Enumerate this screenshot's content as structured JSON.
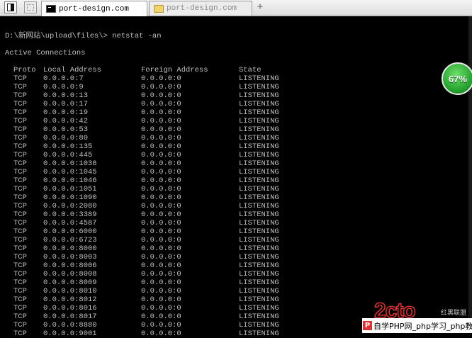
{
  "tabs": [
    {
      "label": "port-design.com",
      "icon": "cmd-icon",
      "active": true
    },
    {
      "label": "port-design.com",
      "icon": "folder-icon",
      "active": false
    }
  ],
  "new_tab_label": "+",
  "console": {
    "command_line": "D:\\新网站\\upload\\files\\> netstat -an",
    "title_line": "Active Connections",
    "headers": {
      "proto": "Proto",
      "local": "Local Address",
      "foreign": "Foreign Address",
      "state": "State"
    },
    "rows": [
      [
        "TCP",
        "0.0.0.0:7",
        "0.0.0.0:0",
        "LISTENING"
      ],
      [
        "TCP",
        "0.0.0.0:9",
        "0.0.0.0:0",
        "LISTENING"
      ],
      [
        "TCP",
        "0.0.0.0:13",
        "0.0.0.0:0",
        "LISTENING"
      ],
      [
        "TCP",
        "0.0.0.0:17",
        "0.0.0.0:0",
        "LISTENING"
      ],
      [
        "TCP",
        "0.0.0.0:19",
        "0.0.0.0:0",
        "LISTENING"
      ],
      [
        "TCP",
        "0.0.0.0:42",
        "0.0.0.0:0",
        "LISTENING"
      ],
      [
        "TCP",
        "0.0.0.0:53",
        "0.0.0.0:0",
        "LISTENING"
      ],
      [
        "TCP",
        "0.0.0.0:80",
        "0.0.0.0:0",
        "LISTENING"
      ],
      [
        "TCP",
        "0.0.0.0:135",
        "0.0.0.0:0",
        "LISTENING"
      ],
      [
        "TCP",
        "0.0.0.0:445",
        "0.0.0.0:0",
        "LISTENING"
      ],
      [
        "TCP",
        "0.0.0.0:1038",
        "0.0.0.0:0",
        "LISTENING"
      ],
      [
        "TCP",
        "0.0.0.0:1045",
        "0.0.0.0:0",
        "LISTENING"
      ],
      [
        "TCP",
        "0.0.0.0:1046",
        "0.0.0.0:0",
        "LISTENING"
      ],
      [
        "TCP",
        "0.0.0.0:1051",
        "0.0.0.0:0",
        "LISTENING"
      ],
      [
        "TCP",
        "0.0.0.0:1090",
        "0.0.0.0:0",
        "LISTENING"
      ],
      [
        "TCP",
        "0.0.0.0:2080",
        "0.0.0.0:0",
        "LISTENING"
      ],
      [
        "TCP",
        "0.0.0.0:3389",
        "0.0.0.0:0",
        "LISTENING"
      ],
      [
        "TCP",
        "0.0.0.0:4587",
        "0.0.0.0:0",
        "LISTENING"
      ],
      [
        "TCP",
        "0.0.0.0:6000",
        "0.0.0.0:0",
        "LISTENING"
      ],
      [
        "TCP",
        "0.0.0.0:6723",
        "0.0.0.0:0",
        "LISTENING"
      ],
      [
        "TCP",
        "0.0.0.0:8000",
        "0.0.0.0:0",
        "LISTENING"
      ],
      [
        "TCP",
        "0.0.0.0:8003",
        "0.0.0.0:0",
        "LISTENING"
      ],
      [
        "TCP",
        "0.0.0.0:8006",
        "0.0.0.0:0",
        "LISTENING"
      ],
      [
        "TCP",
        "0.0.0.0:8008",
        "0.0.0.0:0",
        "LISTENING"
      ],
      [
        "TCP",
        "0.0.0.0:8009",
        "0.0.0.0:0",
        "LISTENING"
      ],
      [
        "TCP",
        "0.0.0.0:8010",
        "0.0.0.0:0",
        "LISTENING"
      ],
      [
        "TCP",
        "0.0.0.0:8012",
        "0.0.0.0:0",
        "LISTENING"
      ],
      [
        "TCP",
        "0.0.0.0:8016",
        "0.0.0.0:0",
        "LISTENING"
      ],
      [
        "TCP",
        "0.0.0.0:8017",
        "0.0.0.0:0",
        "LISTENING"
      ],
      [
        "TCP",
        "0.0.0.0:8880",
        "0.0.0.0:0",
        "LISTENING"
      ],
      [
        "TCP",
        "0.0.0.0:9001",
        "0.0.0.0:0",
        "LISTENING"
      ]
    ]
  },
  "badge": {
    "percent_label": "67%",
    "color": "#2fae37"
  },
  "watermark": {
    "logo_text": "2cto",
    "logo_subtext": "红黑联盟",
    "caption": "自学PHP网_php学习_php教"
  },
  "colors": {
    "console_bg": "#000000",
    "console_text": "#c0c0c0",
    "watermark_red": "#d33333"
  }
}
